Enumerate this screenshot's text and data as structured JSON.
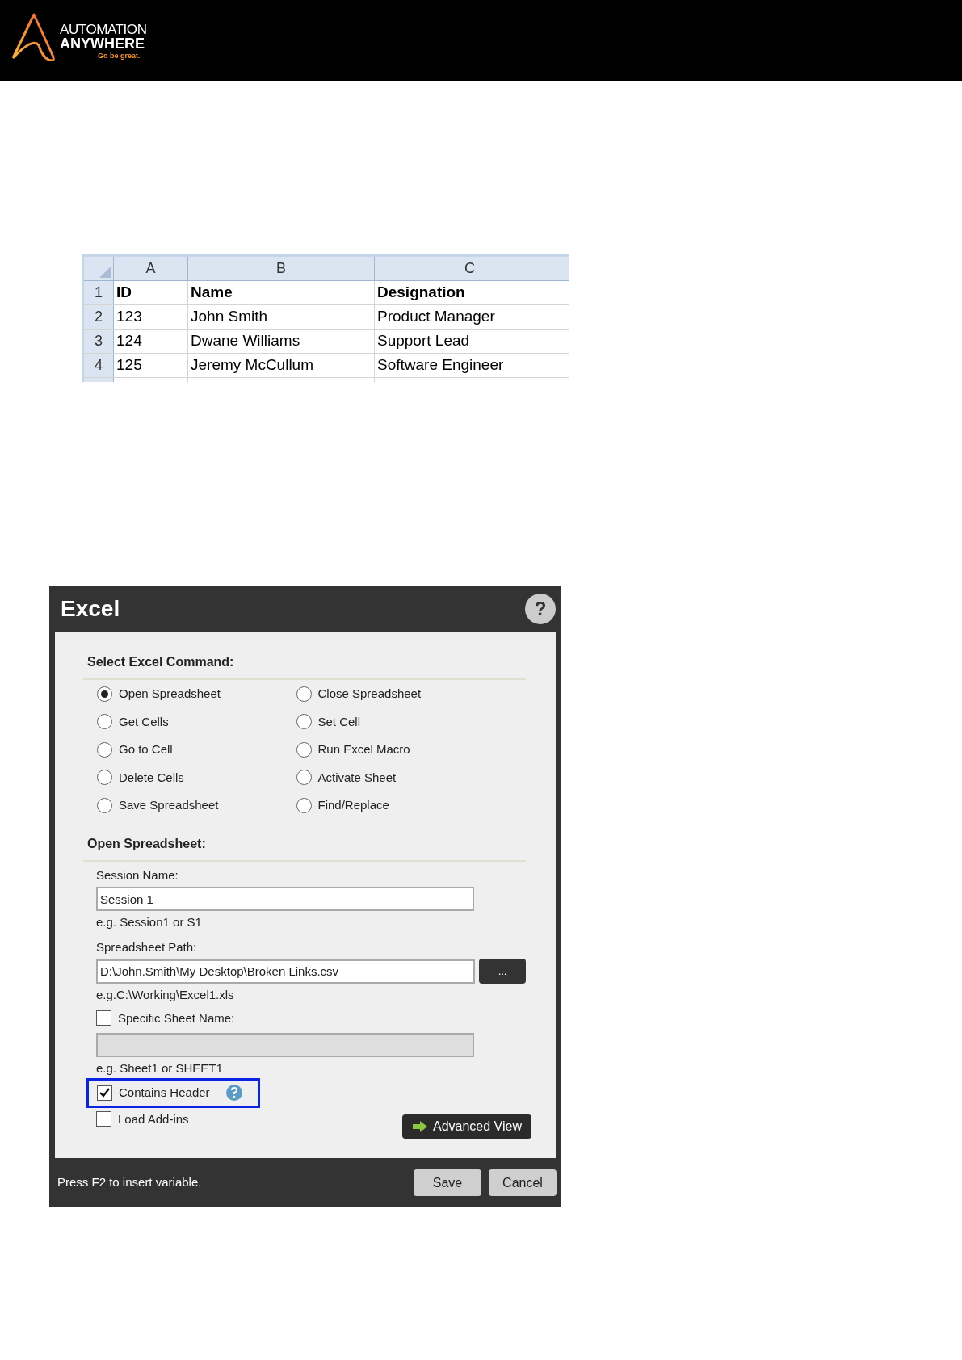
{
  "header": {
    "logo_line1": "AUTOMATION",
    "logo_line2": "ANYWHERE",
    "tagline": "Go be great."
  },
  "spreadsheet": {
    "columns": [
      "A",
      "B",
      "C"
    ],
    "rows": [
      {
        "number": "1",
        "bold": true,
        "cells": [
          "ID",
          "Name",
          "Designation"
        ]
      },
      {
        "number": "2",
        "bold": false,
        "cells": [
          "123",
          "John Smith",
          "Product Manager"
        ]
      },
      {
        "number": "3",
        "bold": false,
        "cells": [
          "124",
          "Dwane Williams",
          "Support Lead"
        ]
      },
      {
        "number": "4",
        "bold": false,
        "cells": [
          "125",
          "Jeremy McCullum",
          "Software Engineer"
        ]
      }
    ]
  },
  "dialog": {
    "title": "Excel",
    "help": "?",
    "command_heading": "Select Excel Command:",
    "commands": [
      {
        "label": "Open Spreadsheet",
        "selected": true
      },
      {
        "label": "Close Spreadsheet",
        "selected": false
      },
      {
        "label": "Get Cells",
        "selected": false
      },
      {
        "label": "Set Cell",
        "selected": false
      },
      {
        "label": "Go to Cell",
        "selected": false
      },
      {
        "label": "Run Excel Macro",
        "selected": false
      },
      {
        "label": "Delete Cells",
        "selected": false
      },
      {
        "label": "Activate Sheet",
        "selected": false
      },
      {
        "label": "Save Spreadsheet",
        "selected": false
      },
      {
        "label": "Find/Replace",
        "selected": false
      }
    ],
    "options_heading": "Open Spreadsheet:",
    "session_name": {
      "label": "Session Name:",
      "value": "Session 1",
      "hint": "e.g. Session1 or S1"
    },
    "spreadsheet_path": {
      "label": "Spreadsheet Path:",
      "value": "D:\\John.Smith\\My Desktop\\Broken Links.csv",
      "browse": "...",
      "hint": "e.g.C:\\Working\\Excel1.xls"
    },
    "specific_sheet": {
      "label": "Specific Sheet Name:",
      "checked": false,
      "field_disabled": true,
      "hint": "e.g. Sheet1 or SHEET1"
    },
    "contains_header": {
      "label": "Contains Header",
      "checked": true,
      "highlighted": true
    },
    "load_addins": {
      "label": "Load Add-ins",
      "checked": false
    },
    "advanced_view": "Advanced View",
    "footer_hint": "Press F2 to insert variable.",
    "buttons": [
      "Save",
      "Cancel"
    ]
  }
}
